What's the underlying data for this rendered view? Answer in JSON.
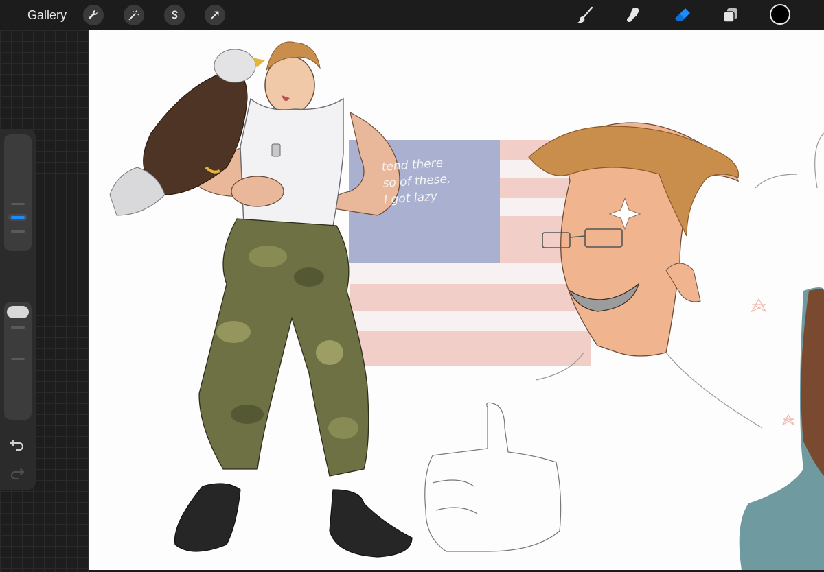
{
  "toolbar": {
    "gallery_label": "Gallery",
    "left_tools": [
      "wrench-icon",
      "magic-wand-icon",
      "selection-s-icon",
      "arrow-transform-icon"
    ],
    "right_tools": [
      "brush-icon",
      "smudge-icon",
      "eraser-icon",
      "layers-icon"
    ],
    "active_tool": "eraser",
    "accent_color": "#1a8cff",
    "current_color": "#000000"
  },
  "sidebar": {
    "brush_size_level": 0.55,
    "opacity_level": 1.0
  },
  "canvas": {
    "background": "#fdfdfd",
    "note_lines": [
      "tend there",
      "so of these,",
      "I got lazy"
    ]
  }
}
